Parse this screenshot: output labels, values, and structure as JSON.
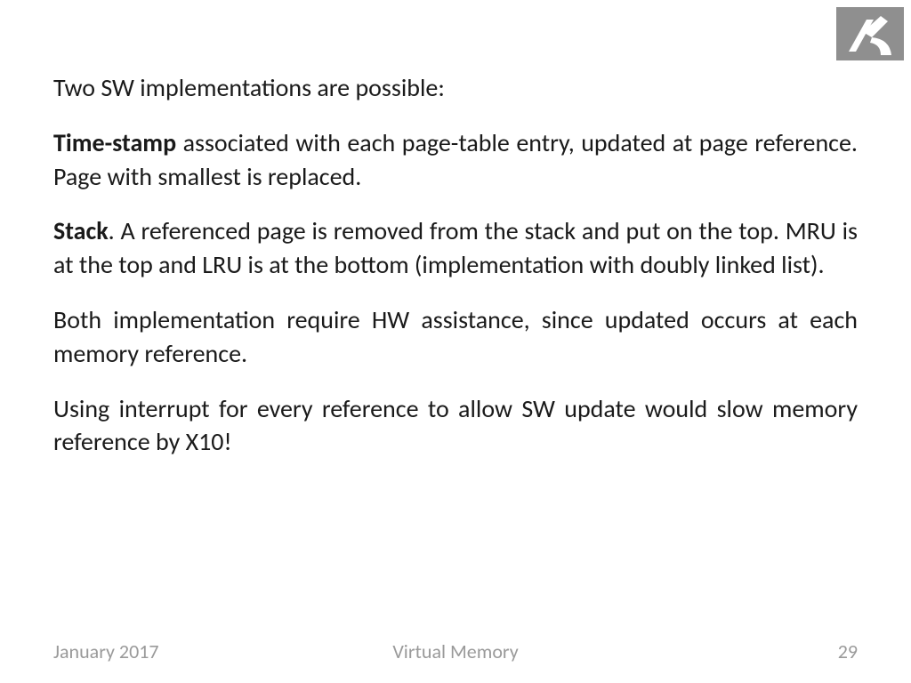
{
  "logo": {
    "alt": "institution-logo"
  },
  "body": {
    "p1": "Two SW implementations are possible:",
    "p2_bold": "Time-stamp",
    "p2_rest": " associated with each page-table entry, updated at page reference. Page with smallest is replaced.",
    "p3_bold": "Stack",
    "p3_rest": ". A referenced page is removed from the stack and put on the top. MRU is at the top and LRU is at the bottom (implementation with doubly linked list).",
    "p4": "Both implementation require HW assistance, since updated occurs at each memory reference.",
    "p5": "Using interrupt for every reference to allow SW update would slow memory reference by X10!"
  },
  "footer": {
    "date": "January 2017",
    "title": "Virtual Memory",
    "page": "29"
  }
}
